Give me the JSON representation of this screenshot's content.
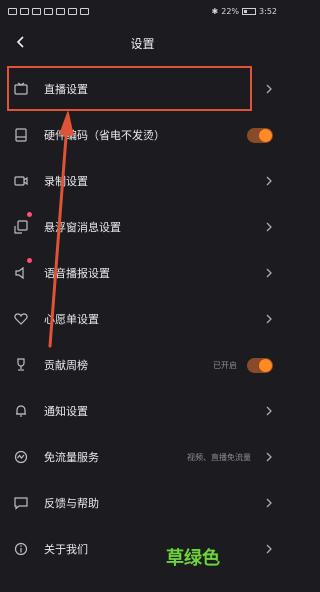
{
  "status": {
    "battery_text": "22%",
    "time": "3:52"
  },
  "header": {
    "title": "设置"
  },
  "items": [
    {
      "label": "直播设置",
      "icon": "tv-icon"
    },
    {
      "label": "硬件编码（省电不发烫）",
      "icon": "device-icon",
      "toggle": true
    },
    {
      "label": "录制设置",
      "icon": "camera-icon"
    },
    {
      "label": "悬浮窗消息设置",
      "icon": "float-window-icon"
    },
    {
      "label": "语音播报设置",
      "icon": "speaker-icon"
    },
    {
      "label": "心愿单设置",
      "icon": "heart-icon"
    },
    {
      "label": "贡献周榜",
      "icon": "trophy-icon",
      "value": "已开启",
      "toggle": true
    },
    {
      "label": "通知设置",
      "icon": "bell-icon"
    },
    {
      "label": "免流量服务",
      "icon": "data-icon",
      "value": "视频、直播免流量"
    },
    {
      "label": "反馈与帮助",
      "icon": "feedback-icon"
    },
    {
      "label": "关于我们",
      "icon": "info-icon"
    }
  ],
  "colors": {
    "accent": "#ff8a24",
    "highlight": "#e05336",
    "background": "#1b1b20"
  },
  "watermark": "草绿色"
}
